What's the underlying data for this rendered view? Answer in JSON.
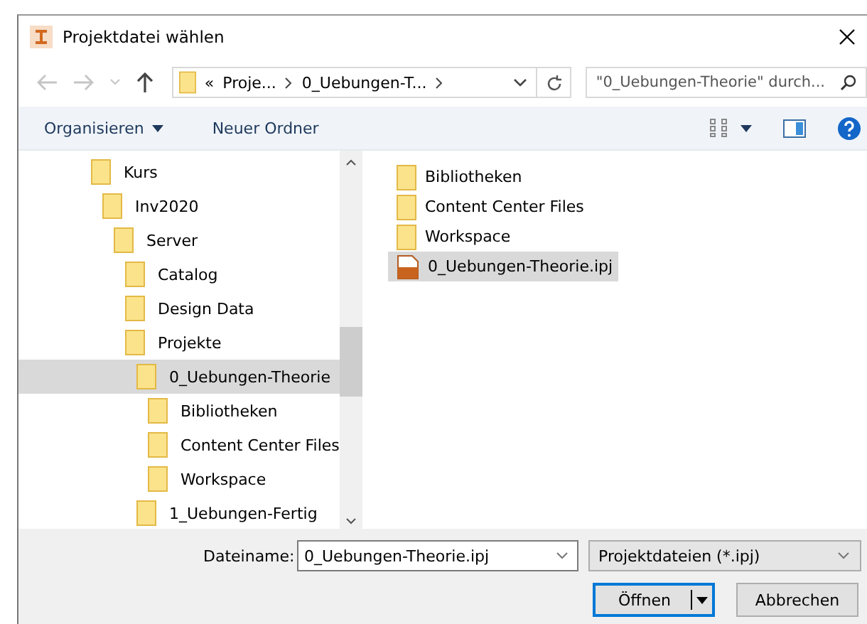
{
  "window": {
    "title": "Projektdatei wählen"
  },
  "nav": {
    "address_prefix": "«",
    "address_segments": [
      "Proje...",
      "0_Uebungen-T..."
    ],
    "search": {
      "placeholder": "\"0_Uebungen-Theorie\" durch..."
    }
  },
  "toolbar": {
    "buttons": [
      {
        "label": "Organisieren",
        "kind": "menu"
      },
      {
        "label": "Neuer Ordner",
        "kind": "plain"
      }
    ]
  },
  "tree": [
    {
      "label": "Kurs",
      "selected": false,
      "children": [
        {
          "label": "Inv2020",
          "selected": false,
          "children": [
            {
              "label": "Server",
              "selected": false,
              "children": [
                {
                  "label": "Catalog",
                  "selected": false
                },
                {
                  "label": "Design Data",
                  "selected": false
                },
                {
                  "label": "Projekte",
                  "selected": false,
                  "children": [
                    {
                      "label": "0_Uebungen-Theorie",
                      "selected": true,
                      "children": [
                        {
                          "label": "Bibliotheken",
                          "selected": false
                        },
                        {
                          "label": "Content Center Files",
                          "selected": false
                        },
                        {
                          "label": "Workspace",
                          "selected": false
                        }
                      ]
                    },
                    {
                      "label": "1_Uebungen-Fertig",
                      "selected": false
                    }
                  ]
                }
              ]
            }
          ]
        }
      ]
    }
  ],
  "files": [
    {
      "name": "Bibliotheken",
      "kind": "folder",
      "selected": false
    },
    {
      "name": "Content Center Files",
      "kind": "folder",
      "selected": false
    },
    {
      "name": "Workspace",
      "kind": "folder",
      "selected": false
    },
    {
      "name": "0_Uebungen-Theorie.ipj",
      "kind": "project",
      "selected": true
    }
  ],
  "bottom": {
    "filename_label": "Dateiname:",
    "filename": "0_Uebungen-Theorie.ipj",
    "filter": "Projektdateien (*.ipj)",
    "buttons": [
      {
        "label": "Öffnen",
        "kind": "split",
        "default": true
      },
      {
        "label": "Abbrechen",
        "kind": "plain",
        "default": false
      }
    ]
  }
}
